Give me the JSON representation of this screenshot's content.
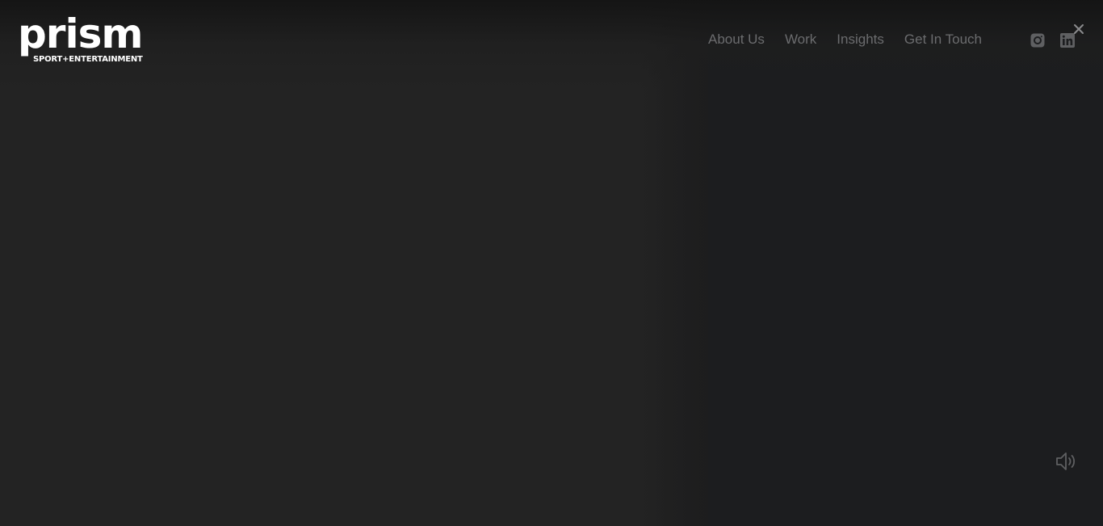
{
  "brand": {
    "logo_word": "prism",
    "logo_sub": "SPORT+ENTERTAINMENT"
  },
  "nav": {
    "items": [
      {
        "label": "About Us"
      },
      {
        "label": "Work"
      },
      {
        "label": "Insights"
      },
      {
        "label": "Get In Touch"
      }
    ]
  },
  "social": {
    "instagram_icon": "instagram-icon",
    "linkedin_icon": "linkedin-icon"
  },
  "controls": {
    "close_icon": "close-icon",
    "volume_icon": "volume-icon"
  },
  "colors": {
    "background": "#232323",
    "panel": "#1c1d1f",
    "nav_text": "#6b6c6e",
    "icon": "#5f6062",
    "logo": "#ffffff"
  }
}
